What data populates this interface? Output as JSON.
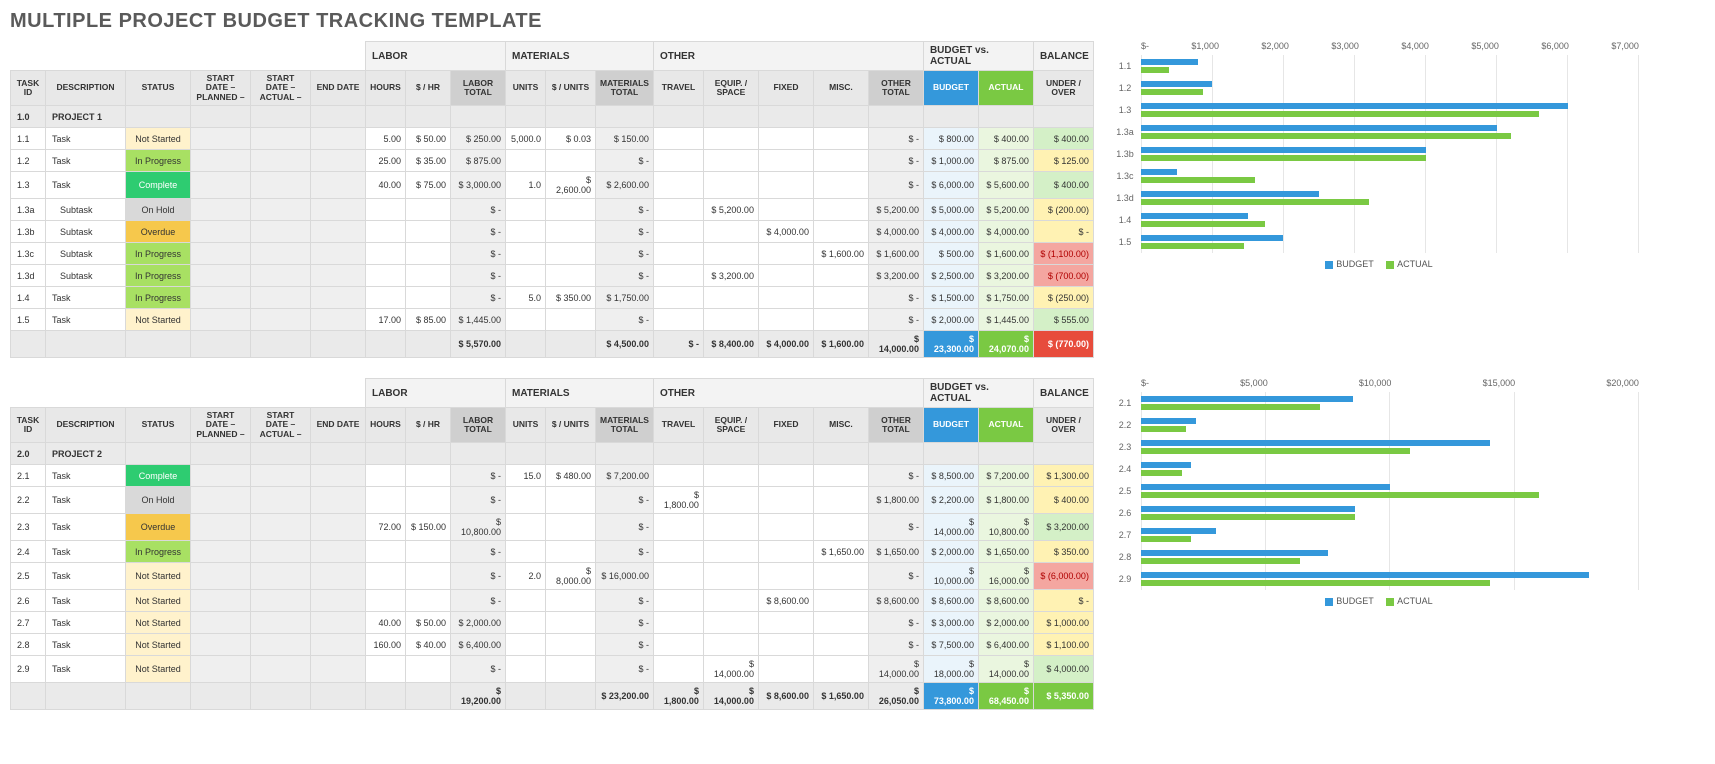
{
  "title": "MULTIPLE PROJECT BUDGET TRACKING TEMPLATE",
  "group_headers": {
    "labor": "LABOR",
    "materials": "MATERIALS",
    "other": "OTHER",
    "bva": "BUDGET vs. ACTUAL",
    "balance": "BALANCE"
  },
  "col_headers": {
    "task_id": "TASK ID",
    "description": "DESCRIPTION",
    "status": "STATUS",
    "start_planned": "START DATE – PLANNED –",
    "start_actual": "START DATE – ACTUAL –",
    "end_date": "END DATE",
    "hours": "HOURS",
    "per_hr": "$ / HR",
    "labor_total": "LABOR TOTAL",
    "units": "UNITS",
    "per_units": "$ / UNITS",
    "materials_total": "MATERIALS TOTAL",
    "travel": "TRAVEL",
    "equip": "EQUIP. / SPACE",
    "fixed": "FIXED",
    "misc": "MISC.",
    "other_total": "OTHER TOTAL",
    "budget": "BUDGET",
    "actual": "ACTUAL",
    "under_over": "UNDER / OVER"
  },
  "legend": {
    "budget": "BUDGET",
    "actual": "ACTUAL"
  },
  "projects": [
    {
      "header": {
        "id": "1.0",
        "name": "PROJECT 1"
      },
      "rows": [
        {
          "id": "1.1",
          "desc": "Task",
          "status": "Not Started",
          "status_cls": "notstarted",
          "hours": "5.00",
          "per_hr": "$   50.00",
          "labor_total": "$      250.00",
          "units": "5,000.0",
          "per_units": "$      0.03",
          "materials_total": "$      150.00",
          "travel": "",
          "equip": "",
          "fixed": "",
          "misc": "",
          "other_total": "$           -",
          "budget": "$      800.00",
          "actual": "$      400.00",
          "balance": "$      400.00",
          "bal_cls": "pos",
          "b": 800,
          "a": 400
        },
        {
          "id": "1.2",
          "desc": "Task",
          "status": "In Progress",
          "status_cls": "inprogress",
          "hours": "25.00",
          "per_hr": "$   35.00",
          "labor_total": "$      875.00",
          "units": "",
          "per_units": "",
          "materials_total": "$           -",
          "travel": "",
          "equip": "",
          "fixed": "",
          "misc": "",
          "other_total": "$           -",
          "budget": "$   1,000.00",
          "actual": "$      875.00",
          "balance": "$      125.00",
          "bal_cls": "small",
          "b": 1000,
          "a": 875
        },
        {
          "id": "1.3",
          "desc": "Task",
          "status": "Complete",
          "status_cls": "complete",
          "hours": "40.00",
          "per_hr": "$   75.00",
          "labor_total": "$   3,000.00",
          "units": "1.0",
          "per_units": "$ 2,600.00",
          "materials_total": "$   2,600.00",
          "travel": "",
          "equip": "",
          "fixed": "",
          "misc": "",
          "other_total": "$           -",
          "budget": "$   6,000.00",
          "actual": "$   5,600.00",
          "balance": "$      400.00",
          "bal_cls": "pos",
          "b": 6000,
          "a": 5600
        },
        {
          "id": "1.3a",
          "desc": "Subtask",
          "status": "On Hold",
          "status_cls": "onhold",
          "hours": "",
          "per_hr": "",
          "labor_total": "$           -",
          "units": "",
          "per_units": "",
          "materials_total": "$           -",
          "travel": "",
          "equip": "$   5,200.00",
          "fixed": "",
          "misc": "",
          "other_total": "$   5,200.00",
          "budget": "$   5,000.00",
          "actual": "$   5,200.00",
          "balance": "$     (200.00)",
          "bal_cls": "small",
          "b": 5000,
          "a": 5200
        },
        {
          "id": "1.3b",
          "desc": "Subtask",
          "status": "Overdue",
          "status_cls": "overdue",
          "hours": "",
          "per_hr": "",
          "labor_total": "$           -",
          "units": "",
          "per_units": "",
          "materials_total": "$           -",
          "travel": "",
          "equip": "",
          "fixed": "$   4,000.00",
          "misc": "",
          "other_total": "$   4,000.00",
          "budget": "$   4,000.00",
          "actual": "$   4,000.00",
          "balance": "$           -",
          "bal_cls": "zero",
          "b": 4000,
          "a": 4000
        },
        {
          "id": "1.3c",
          "desc": "Subtask",
          "status": "In Progress",
          "status_cls": "inprogress",
          "hours": "",
          "per_hr": "",
          "labor_total": "$           -",
          "units": "",
          "per_units": "",
          "materials_total": "$           -",
          "travel": "",
          "equip": "",
          "fixed": "",
          "misc": "$   1,600.00",
          "other_total": "$   1,600.00",
          "budget": "$      500.00",
          "actual": "$   1,600.00",
          "balance": "$  (1,100.00)",
          "bal_cls": "neg",
          "b": 500,
          "a": 1600
        },
        {
          "id": "1.3d",
          "desc": "Subtask",
          "status": "In Progress",
          "status_cls": "inprogress",
          "hours": "",
          "per_hr": "",
          "labor_total": "$           -",
          "units": "",
          "per_units": "",
          "materials_total": "$           -",
          "travel": "",
          "equip": "$   3,200.00",
          "fixed": "",
          "misc": "",
          "other_total": "$   3,200.00",
          "budget": "$   2,500.00",
          "actual": "$   3,200.00",
          "balance": "$     (700.00)",
          "bal_cls": "neg",
          "b": 2500,
          "a": 3200
        },
        {
          "id": "1.4",
          "desc": "Task",
          "status": "In Progress",
          "status_cls": "inprogress",
          "hours": "",
          "per_hr": "",
          "labor_total": "$           -",
          "units": "5.0",
          "per_units": "$    350.00",
          "materials_total": "$   1,750.00",
          "travel": "",
          "equip": "",
          "fixed": "",
          "misc": "",
          "other_total": "$           -",
          "budget": "$   1,500.00",
          "actual": "$   1,750.00",
          "balance": "$     (250.00)",
          "bal_cls": "small",
          "b": 1500,
          "a": 1750
        },
        {
          "id": "1.5",
          "desc": "Task",
          "status": "Not Started",
          "status_cls": "notstarted",
          "hours": "17.00",
          "per_hr": "$   85.00",
          "labor_total": "$   1,445.00",
          "units": "",
          "per_units": "",
          "materials_total": "$           -",
          "travel": "",
          "equip": "",
          "fixed": "",
          "misc": "",
          "other_total": "$           -",
          "budget": "$   2,000.00",
          "actual": "$   1,445.00",
          "balance": "$      555.00",
          "bal_cls": "pos",
          "b": 2000,
          "a": 1445
        }
      ],
      "totals": {
        "labor_total": "$   5,570.00",
        "materials_total": "$   4,500.00",
        "travel": "$           -",
        "equip": "$   8,400.00",
        "fixed": "$   4,000.00",
        "misc": "$   1,600.00",
        "other_total": "$  14,000.00",
        "budget": "$  23,300.00",
        "actual": "$  24,070.00",
        "balance": "$     (770.00)",
        "bal_cls": "neg"
      },
      "chart": {
        "max": 7000,
        "ticks": [
          "$-",
          "$1,000",
          "$2,000",
          "$3,000",
          "$4,000",
          "$5,000",
          "$6,000",
          "$7,000"
        ]
      }
    },
    {
      "header": {
        "id": "2.0",
        "name": "PROJECT 2"
      },
      "rows": [
        {
          "id": "2.1",
          "desc": "Task",
          "status": "Complete",
          "status_cls": "complete",
          "hours": "",
          "per_hr": "",
          "labor_total": "$           -",
          "units": "15.0",
          "per_units": "$    480.00",
          "materials_total": "$   7,200.00",
          "travel": "",
          "equip": "",
          "fixed": "",
          "misc": "",
          "other_total": "$           -",
          "budget": "$   8,500.00",
          "actual": "$   7,200.00",
          "balance": "$   1,300.00",
          "bal_cls": "small",
          "b": 8500,
          "a": 7200
        },
        {
          "id": "2.2",
          "desc": "Task",
          "status": "On Hold",
          "status_cls": "onhold",
          "hours": "",
          "per_hr": "",
          "labor_total": "$           -",
          "units": "",
          "per_units": "",
          "materials_total": "$           -",
          "travel": "$   1,800.00",
          "equip": "",
          "fixed": "",
          "misc": "",
          "other_total": "$   1,800.00",
          "budget": "$   2,200.00",
          "actual": "$   1,800.00",
          "balance": "$      400.00",
          "bal_cls": "small",
          "b": 2200,
          "a": 1800
        },
        {
          "id": "2.3",
          "desc": "Task",
          "status": "Overdue",
          "status_cls": "overdue",
          "hours": "72.00",
          "per_hr": "$  150.00",
          "labor_total": "$  10,800.00",
          "units": "",
          "per_units": "",
          "materials_total": "$           -",
          "travel": "",
          "equip": "",
          "fixed": "",
          "misc": "",
          "other_total": "$           -",
          "budget": "$  14,000.00",
          "actual": "$  10,800.00",
          "balance": "$   3,200.00",
          "bal_cls": "pos",
          "b": 14000,
          "a": 10800
        },
        {
          "id": "2.4",
          "desc": "Task",
          "status": "In Progress",
          "status_cls": "inprogress",
          "hours": "",
          "per_hr": "",
          "labor_total": "$           -",
          "units": "",
          "per_units": "",
          "materials_total": "$           -",
          "travel": "",
          "equip": "",
          "fixed": "",
          "misc": "$   1,650.00",
          "other_total": "$   1,650.00",
          "budget": "$   2,000.00",
          "actual": "$   1,650.00",
          "balance": "$      350.00",
          "bal_cls": "small",
          "b": 2000,
          "a": 1650
        },
        {
          "id": "2.5",
          "desc": "Task",
          "status": "Not Started",
          "status_cls": "notstarted",
          "hours": "",
          "per_hr": "",
          "labor_total": "$           -",
          "units": "2.0",
          "per_units": "$ 8,000.00",
          "materials_total": "$  16,000.00",
          "travel": "",
          "equip": "",
          "fixed": "",
          "misc": "",
          "other_total": "$           -",
          "budget": "$  10,000.00",
          "actual": "$  16,000.00",
          "balance": "$  (6,000.00)",
          "bal_cls": "neg",
          "b": 10000,
          "a": 16000
        },
        {
          "id": "2.6",
          "desc": "Task",
          "status": "Not Started",
          "status_cls": "notstarted",
          "hours": "",
          "per_hr": "",
          "labor_total": "$           -",
          "units": "",
          "per_units": "",
          "materials_total": "$           -",
          "travel": "",
          "equip": "",
          "fixed": "$   8,600.00",
          "misc": "",
          "other_total": "$   8,600.00",
          "budget": "$   8,600.00",
          "actual": "$   8,600.00",
          "balance": "$           -",
          "bal_cls": "zero",
          "b": 8600,
          "a": 8600
        },
        {
          "id": "2.7",
          "desc": "Task",
          "status": "Not Started",
          "status_cls": "notstarted",
          "hours": "40.00",
          "per_hr": "$   50.00",
          "labor_total": "$   2,000.00",
          "units": "",
          "per_units": "",
          "materials_total": "$           -",
          "travel": "",
          "equip": "",
          "fixed": "",
          "misc": "",
          "other_total": "$           -",
          "budget": "$   3,000.00",
          "actual": "$   2,000.00",
          "balance": "$   1,000.00",
          "bal_cls": "small",
          "b": 3000,
          "a": 2000
        },
        {
          "id": "2.8",
          "desc": "Task",
          "status": "Not Started",
          "status_cls": "notstarted",
          "hours": "160.00",
          "per_hr": "$   40.00",
          "labor_total": "$   6,400.00",
          "units": "",
          "per_units": "",
          "materials_total": "$           -",
          "travel": "",
          "equip": "",
          "fixed": "",
          "misc": "",
          "other_total": "$           -",
          "budget": "$   7,500.00",
          "actual": "$   6,400.00",
          "balance": "$   1,100.00",
          "bal_cls": "small",
          "b": 7500,
          "a": 6400
        },
        {
          "id": "2.9",
          "desc": "Task",
          "status": "Not Started",
          "status_cls": "notstarted",
          "hours": "",
          "per_hr": "",
          "labor_total": "$           -",
          "units": "",
          "per_units": "",
          "materials_total": "$           -",
          "travel": "",
          "equip": "$  14,000.00",
          "fixed": "",
          "misc": "",
          "other_total": "$  14,000.00",
          "budget": "$  18,000.00",
          "actual": "$  14,000.00",
          "balance": "$   4,000.00",
          "bal_cls": "pos",
          "b": 18000,
          "a": 14000
        }
      ],
      "totals": {
        "labor_total": "$  19,200.00",
        "materials_total": "$  23,200.00",
        "travel": "$   1,800.00",
        "equip": "$  14,000.00",
        "fixed": "$   8,600.00",
        "misc": "$   1,650.00",
        "other_total": "$  26,050.00",
        "budget": "$  73,800.00",
        "actual": "$  68,450.00",
        "balance": "$   5,350.00",
        "bal_cls": "pos"
      },
      "chart": {
        "max": 20000,
        "ticks": [
          "$-",
          "$5,000",
          "$10,000",
          "$15,000",
          "$20,000"
        ]
      }
    }
  ],
  "chart_data": [
    {
      "type": "bar",
      "title": "",
      "xlabel": "",
      "ylabel": "",
      "orientation": "horizontal",
      "categories": [
        "1.1",
        "1.2",
        "1.3",
        "1.3a",
        "1.3b",
        "1.3c",
        "1.3d",
        "1.4",
        "1.5"
      ],
      "series": [
        {
          "name": "BUDGET",
          "values": [
            800,
            1000,
            6000,
            5000,
            4000,
            500,
            2500,
            1500,
            2000
          ]
        },
        {
          "name": "ACTUAL",
          "values": [
            400,
            875,
            5600,
            5200,
            4000,
            1600,
            3200,
            1750,
            1445
          ]
        }
      ],
      "xlim": [
        0,
        7000
      ],
      "x_ticks": [
        0,
        1000,
        2000,
        3000,
        4000,
        5000,
        6000,
        7000
      ]
    },
    {
      "type": "bar",
      "title": "",
      "xlabel": "",
      "ylabel": "",
      "orientation": "horizontal",
      "categories": [
        "2.1",
        "2.2",
        "2.3",
        "2.4",
        "2.5",
        "2.6",
        "2.7",
        "2.8",
        "2.9"
      ],
      "series": [
        {
          "name": "BUDGET",
          "values": [
            8500,
            2200,
            14000,
            2000,
            10000,
            8600,
            3000,
            7500,
            18000
          ]
        },
        {
          "name": "ACTUAL",
          "values": [
            7200,
            1800,
            10800,
            1650,
            16000,
            8600,
            2000,
            6400,
            14000
          ]
        }
      ],
      "xlim": [
        0,
        20000
      ],
      "x_ticks": [
        0,
        5000,
        10000,
        15000,
        20000
      ]
    }
  ]
}
